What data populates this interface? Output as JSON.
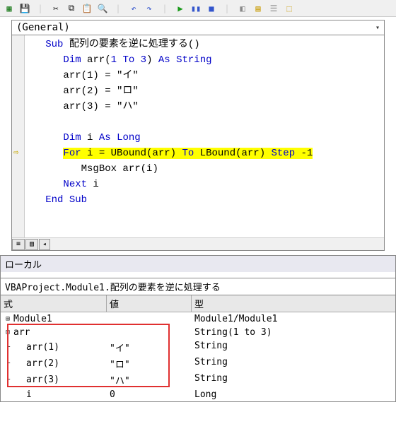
{
  "toolbar": {
    "icons": [
      "excel-icon",
      "separator",
      "save-icon",
      "separator",
      "cut-icon",
      "copy-icon",
      "paste-icon",
      "find-icon",
      "separator",
      "undo-icon",
      "redo-icon",
      "separator",
      "run-icon",
      "pause-icon",
      "stop-icon",
      "separator",
      "design-icon",
      "project-icon",
      "props-icon",
      "object-icon"
    ]
  },
  "dropdown": {
    "value": "(General)"
  },
  "code": {
    "lines": [
      {
        "indent": 1,
        "segs": [
          [
            "kw",
            "Sub"
          ],
          [
            "lit",
            " 配列の要素を逆に処理する()"
          ]
        ]
      },
      {
        "indent": 2,
        "segs": [
          [
            "kw",
            "Dim"
          ],
          [
            "lit",
            " arr("
          ],
          [
            "kw",
            "1 To 3"
          ],
          [
            "lit",
            ") "
          ],
          [
            "kw",
            "As String"
          ]
        ]
      },
      {
        "indent": 2,
        "segs": [
          [
            "lit",
            "arr(1) = \"イ\""
          ]
        ]
      },
      {
        "indent": 2,
        "segs": [
          [
            "lit",
            "arr(2) = \"ロ\""
          ]
        ]
      },
      {
        "indent": 2,
        "segs": [
          [
            "lit",
            "arr(3) = \"ハ\""
          ]
        ]
      },
      {
        "indent": 2,
        "segs": [
          [
            "lit",
            ""
          ]
        ]
      },
      {
        "indent": 2,
        "segs": [
          [
            "kw",
            "Dim"
          ],
          [
            "lit",
            " i "
          ],
          [
            "kw",
            "As Long"
          ]
        ]
      },
      {
        "indent": 2,
        "hl": true,
        "exec": true,
        "segs": [
          [
            "kw",
            "For"
          ],
          [
            "lit",
            " i = UBound(arr) "
          ],
          [
            "kw",
            "To"
          ],
          [
            "lit",
            " LBound(arr) "
          ],
          [
            "kw",
            "Step"
          ],
          [
            "lit",
            " -1"
          ]
        ]
      },
      {
        "indent": 3,
        "segs": [
          [
            "lit",
            "MsgBox arr(i)"
          ]
        ]
      },
      {
        "indent": 2,
        "segs": [
          [
            "kw",
            "Next"
          ],
          [
            "lit",
            " i"
          ]
        ]
      },
      {
        "indent": 1,
        "segs": [
          [
            "kw",
            "End Sub"
          ]
        ]
      }
    ]
  },
  "locals": {
    "title": "ローカル",
    "context": "VBAProject.Module1.配列の要素を逆に処理する",
    "columns": {
      "exp": "式",
      "val": "値",
      "type": "型"
    },
    "rows": [
      {
        "glyph": "⊞",
        "level": 0,
        "exp": "Module1",
        "val": "",
        "type": "Module1/Module1"
      },
      {
        "glyph": "⊟",
        "level": 0,
        "exp": "arr",
        "val": "",
        "type": "String(1 to 3)"
      },
      {
        "glyph": "├",
        "level": 1,
        "exp": "arr(1)",
        "val": "\"イ\"",
        "type": "String"
      },
      {
        "glyph": "├",
        "level": 1,
        "exp": "arr(2)",
        "val": "\"ロ\"",
        "type": "String"
      },
      {
        "glyph": "└",
        "level": 1,
        "exp": "arr(3)",
        "val": "\"ハ\"",
        "type": "String"
      },
      {
        "glyph": "",
        "level": 1,
        "exp": "i",
        "val": "0",
        "type": "Long"
      }
    ]
  }
}
